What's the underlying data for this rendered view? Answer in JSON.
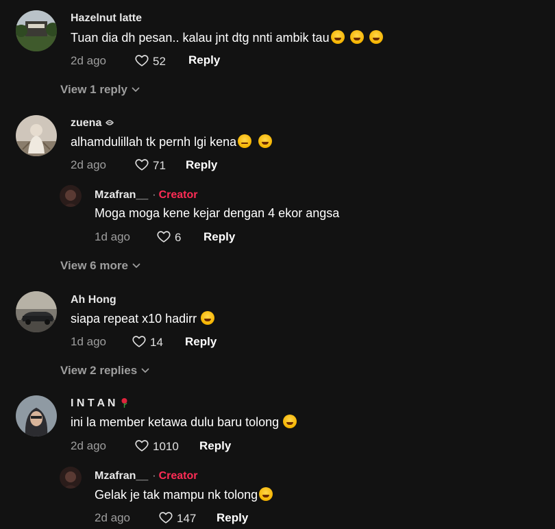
{
  "comments": [
    {
      "username": "Hazelnut latte",
      "text": "Tuan dia dh pesan.. kalau jnt dtg nnti ambik tau",
      "time": "2d ago",
      "likes": "52",
      "reply_label": "Reply",
      "view_more": "View 1 reply"
    },
    {
      "username": "zuena",
      "text": "alhamdulillah tk pernh lgi kena",
      "time": "2d ago",
      "likes": "71",
      "reply_label": "Reply",
      "reply": {
        "username": "Mzafran__",
        "separator": "·",
        "badge": "Creator",
        "text": "Moga moga kene kejar dengan 4 ekor angsa",
        "time": "1d ago",
        "likes": "6",
        "reply_label": "Reply"
      },
      "view_more": "View 6 more"
    },
    {
      "username": "Ah Hong",
      "text": "siapa repeat x10 hadirr",
      "time": "1d ago",
      "likes": "14",
      "reply_label": "Reply",
      "view_more": "View 2 replies"
    },
    {
      "username": "I N T A N",
      "text": "ini la member ketawa dulu baru tolong",
      "time": "2d ago",
      "likes": "1010",
      "reply_label": "Reply",
      "reply": {
        "username": "Mzafran__",
        "separator": "·",
        "badge": "Creator",
        "text": "Gelak je tak mampu nk tolong",
        "time": "2d ago",
        "likes": "147",
        "reply_label": "Reply"
      }
    }
  ],
  "icons": {
    "like": "heart-outline-icon",
    "expand": "chevron-down-icon",
    "emoji_laugh": "rolling-laughing-emoji",
    "emoji_sad": "pensive-emoji",
    "emoji_grin": "grinning-squinting-emoji",
    "username_decoration": "rose-emoji"
  },
  "colors": {
    "background": "#121212",
    "creator_badge": "#fe2c55",
    "secondary_text": "#9e9e9e"
  }
}
